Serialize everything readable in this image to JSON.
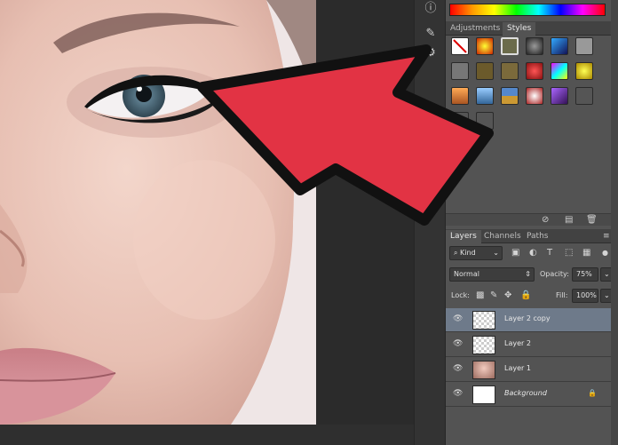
{
  "app": {
    "accent": "#e23344"
  },
  "adjustments_panel": {
    "tabs": [
      "Adjustments",
      "Styles"
    ],
    "active_tab": "Styles"
  },
  "layers_panel": {
    "tabs": [
      "Layers",
      "Channels",
      "Paths"
    ],
    "active_tab": "Layers",
    "filter_kind": "Kind",
    "blend_mode": "Normal",
    "opacity_label": "Opacity:",
    "opacity_value": "75%",
    "lock_label": "Lock:",
    "fill_label": "Fill:",
    "fill_value": "100%",
    "layers": [
      {
        "name": "Layer 2 copy",
        "selected": true,
        "thumb": "transparent"
      },
      {
        "name": "Layer 2",
        "selected": false,
        "thumb": "transparent"
      },
      {
        "name": "Layer 1",
        "selected": false,
        "thumb": "face"
      },
      {
        "name": "Background",
        "selected": false,
        "thumb": "white",
        "locked": true
      }
    ]
  },
  "icons": {
    "visibility": "eye-icon",
    "lock": "lock-icon",
    "filter": "search-icon"
  }
}
